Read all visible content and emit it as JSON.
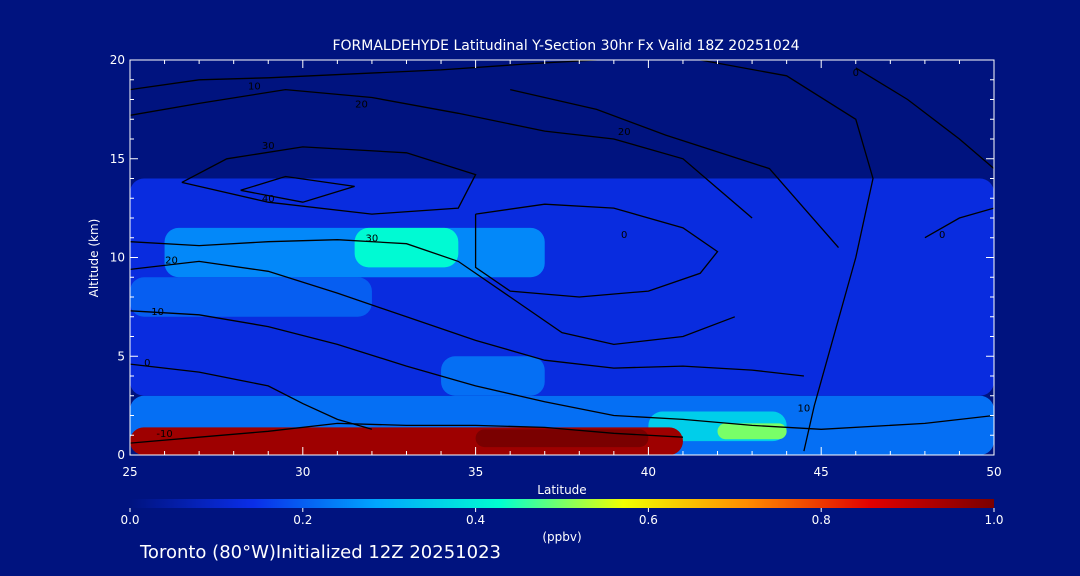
{
  "chart_data": {
    "type": "heatmap",
    "title": "FORMALDEHYDE Latitudinal Y-Section 30hr  Fx Valid 18Z 20251024",
    "xlabel": "Latitude",
    "ylabel": "Altitude (km)",
    "xlim": [
      25,
      50
    ],
    "ylim": [
      0,
      20
    ],
    "x_ticks": [
      "25",
      "30",
      "35",
      "40",
      "45",
      "50"
    ],
    "y_ticks": [
      "0",
      "5",
      "10",
      "15",
      "20"
    ],
    "colorbar": {
      "ticks": [
        "0.0",
        "0.2",
        "0.4",
        "0.6",
        "0.8",
        "1.0"
      ],
      "unit": "(ppbv)",
      "range": [
        0,
        1
      ],
      "colors": [
        "#00137f",
        "#0a2ee8",
        "#00a6ff",
        "#00ffd0",
        "#f2ff00",
        "#ff8c00",
        "#e00000",
        "#7a0000"
      ]
    },
    "regions": [
      {
        "lat": [
          25,
          50
        ],
        "alt": [
          0,
          3
        ],
        "value": 0.22
      },
      {
        "lat": [
          25,
          50
        ],
        "alt": [
          3,
          14
        ],
        "value": 0.13
      },
      {
        "lat": [
          26,
          37
        ],
        "alt": [
          9,
          11.5
        ],
        "value": 0.25
      },
      {
        "lat": [
          31.5,
          34.5
        ],
        "alt": [
          9.5,
          11.5
        ],
        "value": 0.42
      },
      {
        "lat": [
          25,
          32
        ],
        "alt": [
          7,
          9
        ],
        "value": 0.2
      },
      {
        "lat": [
          34,
          37
        ],
        "alt": [
          3,
          5
        ],
        "value": 0.22
      },
      {
        "lat": [
          40,
          44
        ],
        "alt": [
          0.7,
          2.2
        ],
        "value": 0.35
      },
      {
        "lat": [
          42,
          44
        ],
        "alt": [
          0.8,
          1.6
        ],
        "value": 0.5
      },
      {
        "lat": [
          25,
          41
        ],
        "alt": [
          0,
          1.4
        ],
        "value": 0.95
      },
      {
        "lat": [
          35,
          40
        ],
        "alt": [
          0.4,
          1.3
        ],
        "value": 1.0
      }
    ],
    "contour_lines": [
      {
        "label": "-10",
        "label_pos": [
          26,
          0.9
        ],
        "points": [
          [
            25,
            0.6
          ],
          [
            27,
            0.9
          ],
          [
            29,
            1.2
          ],
          [
            31,
            1.6
          ],
          [
            33,
            1.5
          ],
          [
            35,
            1.5
          ],
          [
            37,
            1.4
          ],
          [
            39,
            1.1
          ],
          [
            41,
            0.9
          ]
        ]
      },
      {
        "label": "0",
        "label_pos": [
          25.5,
          4.5
        ],
        "points": [
          [
            25,
            4.6
          ],
          [
            27,
            4.2
          ],
          [
            29,
            3.5
          ],
          [
            30,
            2.6
          ],
          [
            31,
            1.8
          ],
          [
            32,
            1.3
          ]
        ]
      },
      {
        "label": "0",
        "label_pos": [
          46,
          19.2
        ],
        "points": [
          [
            46,
            19.6
          ],
          [
            47.5,
            18
          ],
          [
            49,
            16
          ],
          [
            50,
            14.5
          ]
        ]
      },
      {
        "label": "10",
        "label_pos": [
          25.8,
          7.1
        ],
        "points": [
          [
            25,
            7.3
          ],
          [
            27,
            7.1
          ],
          [
            29,
            6.5
          ],
          [
            31,
            5.6
          ],
          [
            33,
            4.5
          ],
          [
            35,
            3.5
          ],
          [
            37,
            2.7
          ],
          [
            39,
            2.0
          ],
          [
            41,
            1.8
          ],
          [
            43,
            1.5
          ],
          [
            45,
            1.3
          ],
          [
            48,
            1.6
          ],
          [
            50,
            2
          ]
        ]
      },
      {
        "label": "20",
        "label_pos": [
          26.2,
          9.7
        ],
        "points": [
          [
            25,
            9.4
          ],
          [
            27,
            9.8
          ],
          [
            29,
            9.3
          ],
          [
            31,
            8.2
          ],
          [
            33,
            7
          ],
          [
            35,
            5.8
          ],
          [
            37,
            4.8
          ],
          [
            39,
            4.4
          ],
          [
            41,
            4.5
          ],
          [
            43,
            4.3
          ],
          [
            44.5,
            4.0
          ]
        ]
      },
      {
        "label": "30",
        "label_pos": [
          32,
          10.8
        ],
        "points": [
          [
            25,
            10.8
          ],
          [
            27,
            10.6
          ],
          [
            29,
            10.8
          ],
          [
            31,
            10.9
          ],
          [
            33,
            10.7
          ],
          [
            34.5,
            9.8
          ],
          [
            36,
            8.0
          ],
          [
            37.5,
            6.2
          ],
          [
            39,
            5.6
          ],
          [
            41,
            6.0
          ],
          [
            42.5,
            7.0
          ]
        ]
      },
      {
        "label": "0",
        "label_pos": [
          39.3,
          11
        ],
        "points": [
          [
            35,
            12.2
          ],
          [
            37,
            12.7
          ],
          [
            39,
            12.5
          ],
          [
            41,
            11.5
          ],
          [
            42,
            10.3
          ],
          [
            41.5,
            9.2
          ],
          [
            40,
            8.3
          ],
          [
            38,
            8.0
          ],
          [
            36,
            8.3
          ],
          [
            35,
            9.5
          ],
          [
            35,
            12.2
          ]
        ]
      },
      {
        "label": "30",
        "label_pos": [
          29,
          15.5
        ],
        "points": [
          [
            26.5,
            13.8
          ],
          [
            27.8,
            15.0
          ],
          [
            30,
            15.6
          ],
          [
            33,
            15.3
          ],
          [
            35,
            14.2
          ],
          [
            34.5,
            12.5
          ],
          [
            32,
            12.2
          ],
          [
            29,
            12.8
          ],
          [
            26.5,
            13.8
          ]
        ]
      },
      {
        "label": "40",
        "label_pos": [
          29,
          12.8
        ],
        "points": [
          [
            28.2,
            13.4
          ],
          [
            29.5,
            14.1
          ],
          [
            31.5,
            13.6
          ],
          [
            30,
            12.8
          ],
          [
            28.2,
            13.4
          ]
        ]
      },
      {
        "label": "20",
        "label_pos": [
          31.7,
          17.6
        ],
        "points": [
          [
            25,
            17.2
          ],
          [
            27,
            17.8
          ],
          [
            29.5,
            18.5
          ],
          [
            32,
            18.1
          ],
          [
            34.5,
            17.3
          ],
          [
            37,
            16.4
          ],
          [
            39,
            16
          ],
          [
            41,
            15
          ],
          [
            42,
            13.5
          ],
          [
            43,
            12
          ]
        ]
      },
      {
        "label": "10",
        "label_pos": [
          28.6,
          18.5
        ],
        "points": [
          [
            25,
            18.5
          ],
          [
            27,
            19.0
          ],
          [
            29,
            19.1
          ],
          [
            31.5,
            19.3
          ],
          [
            34,
            19.5
          ],
          [
            36.5,
            19.8
          ],
          [
            38.5,
            20
          ]
        ]
      },
      {
        "label": "20",
        "label_pos": [
          39.3,
          16.2
        ],
        "points": [
          [
            36,
            18.5
          ],
          [
            38.5,
            17.5
          ],
          [
            40.5,
            16.2
          ],
          [
            43.5,
            14.5
          ],
          [
            44.5,
            12.5
          ],
          [
            45.5,
            10.5
          ]
        ]
      },
      {
        "label": "10",
        "label_pos": [
          44.5,
          2.2
        ],
        "points": [
          [
            44.5,
            0.2
          ],
          [
            44.8,
            2.5
          ],
          [
            45.2,
            5
          ],
          [
            46,
            10
          ],
          [
            46.5,
            14
          ],
          [
            46,
            17
          ],
          [
            44,
            19.2
          ],
          [
            41.5,
            20
          ]
        ]
      },
      {
        "label": "0",
        "label_pos": [
          48.5,
          11
        ],
        "points": [
          [
            48,
            11
          ],
          [
            49,
            12
          ],
          [
            50,
            12.5
          ]
        ]
      }
    ]
  }
}
